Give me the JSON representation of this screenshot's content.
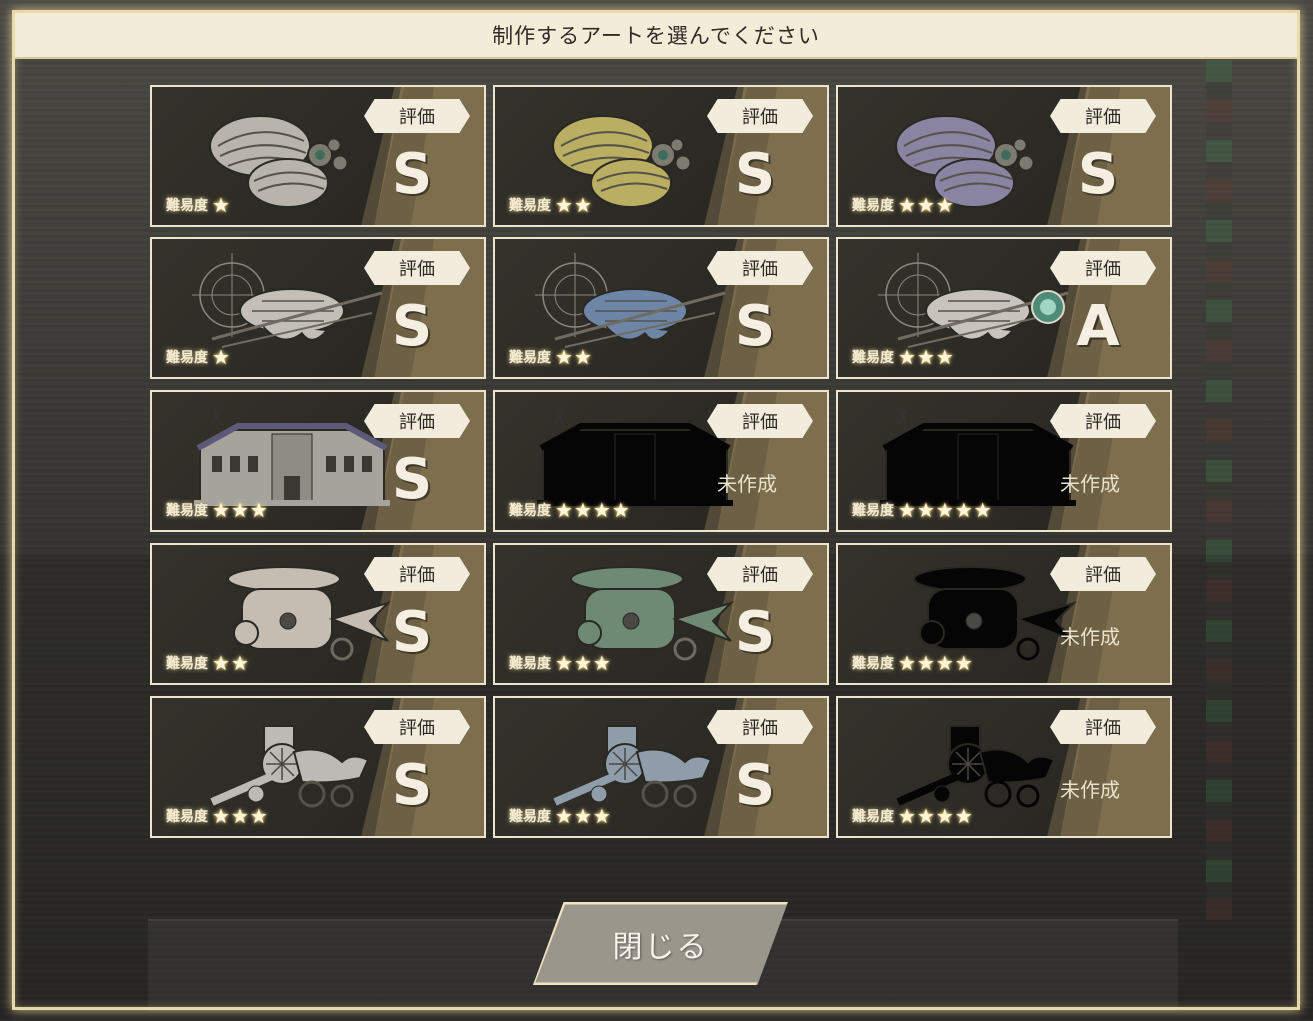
{
  "header": {
    "title": "制作するアートを選んでください"
  },
  "rating_label": "評価",
  "difficulty_label": "難易度",
  "star_glyph": "★",
  "close_button": {
    "label": "閉じる"
  },
  "cards": [
    {
      "art": "shell-machine-white-art",
      "art_color": "#b8b4ab",
      "silhouette": false,
      "difficulty": 1,
      "grade": "S",
      "status": ""
    },
    {
      "art": "shell-machine-yellow-art",
      "art_color": "#b9ae62",
      "silhouette": false,
      "difficulty": 2,
      "grade": "S",
      "status": ""
    },
    {
      "art": "shell-machine-purple-art",
      "art_color": "#8a84a3",
      "silhouette": false,
      "difficulty": 3,
      "grade": "S",
      "status": ""
    },
    {
      "art": "airship-white-art",
      "art_color": "#c3bfb7",
      "silhouette": false,
      "difficulty": 1,
      "grade": "S",
      "status": ""
    },
    {
      "art": "airship-blue-art",
      "art_color": "#6d86a8",
      "silhouette": false,
      "difficulty": 2,
      "grade": "S",
      "status": ""
    },
    {
      "art": "airship-lantern-art",
      "art_color": "#c9c3bd",
      "silhouette": false,
      "difficulty": 3,
      "grade": "A",
      "status": ""
    },
    {
      "art": "mansion-art",
      "art_color": "#a6a39c",
      "silhouette": false,
      "difficulty": 3,
      "grade": "S",
      "status": ""
    },
    {
      "art": "mansion-silhouette-art",
      "art_color": "#050505",
      "silhouette": true,
      "difficulty": 4,
      "grade": "",
      "status": "未作成"
    },
    {
      "art": "mansion-silhouette-art",
      "art_color": "#050505",
      "silhouette": true,
      "difficulty": 5,
      "grade": "",
      "status": "未作成"
    },
    {
      "art": "fish-submarine-white-art",
      "art_color": "#c5bdb2",
      "silhouette": false,
      "difficulty": 2,
      "grade": "S",
      "status": ""
    },
    {
      "art": "fish-submarine-green-art",
      "art_color": "#6f8a74",
      "silhouette": false,
      "difficulty": 3,
      "grade": "S",
      "status": ""
    },
    {
      "art": "fish-submarine-silhouette-art",
      "art_color": "#050505",
      "silhouette": true,
      "difficulty": 4,
      "grade": "",
      "status": "未作成"
    },
    {
      "art": "cannon-cart-white-art",
      "art_color": "#bcbab5",
      "silhouette": false,
      "difficulty": 3,
      "grade": "S",
      "status": ""
    },
    {
      "art": "cannon-cart-blue-art",
      "art_color": "#8f9dab",
      "silhouette": false,
      "difficulty": 3,
      "grade": "S",
      "status": ""
    },
    {
      "art": "cannon-cart-silhouette-art",
      "art_color": "#050505",
      "silhouette": true,
      "difficulty": 4,
      "grade": "",
      "status": "未作成"
    }
  ]
}
